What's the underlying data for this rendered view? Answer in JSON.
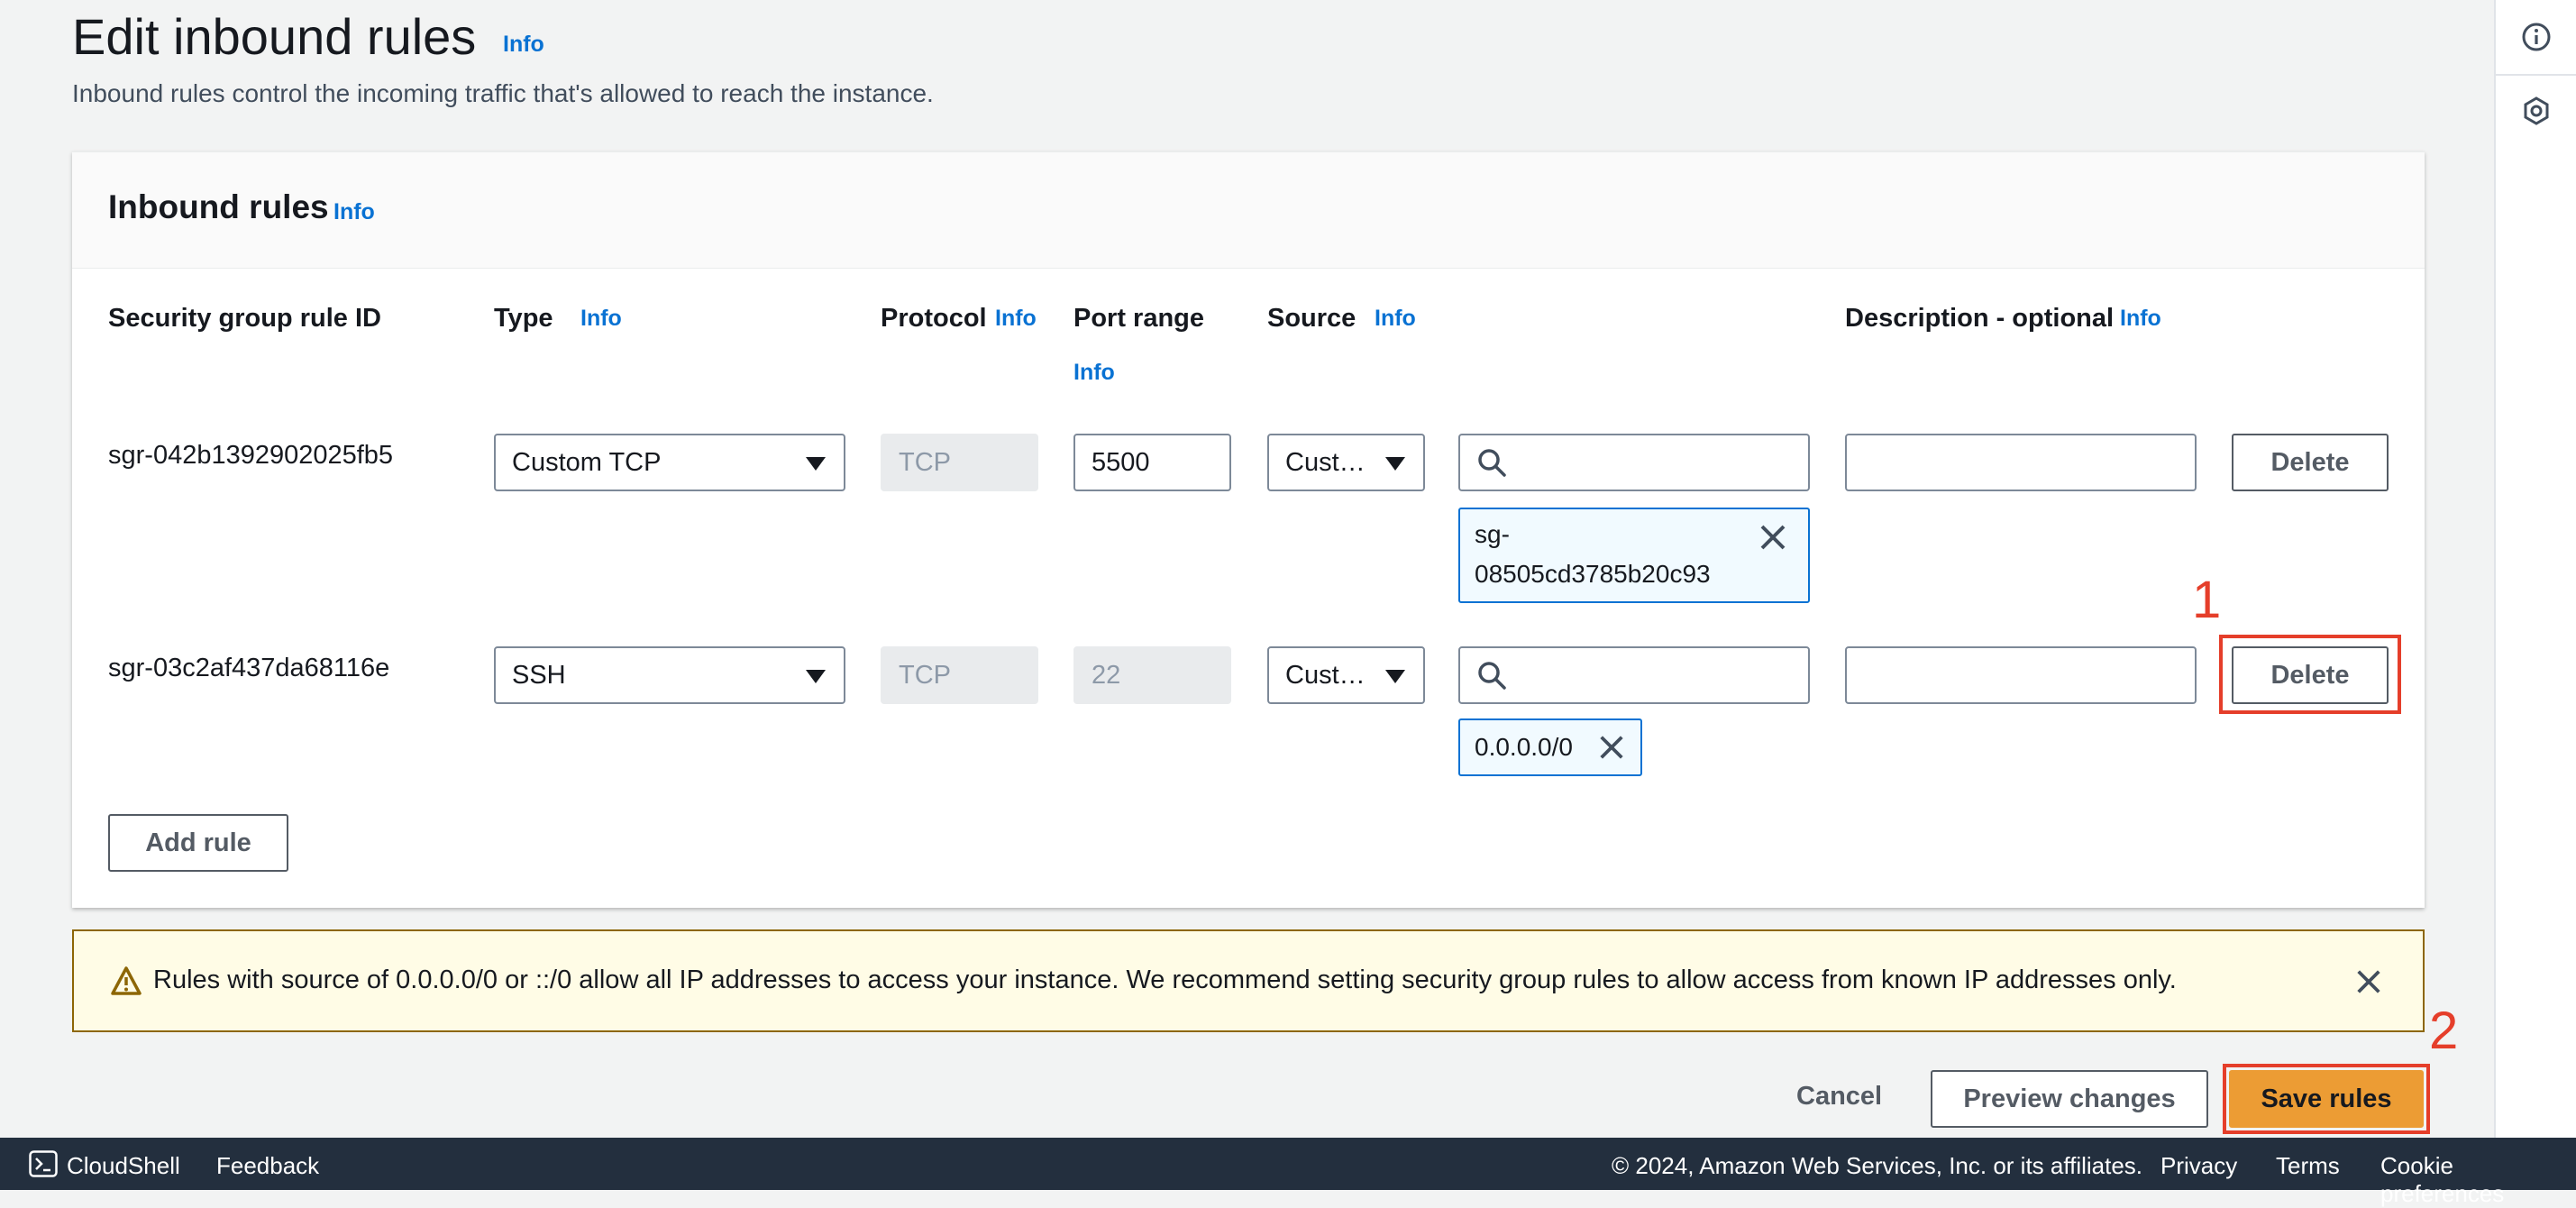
{
  "header": {
    "title": "Edit inbound rules",
    "info": "Info",
    "description": "Inbound rules control the incoming traffic that's allowed to reach the instance."
  },
  "panel": {
    "title": "Inbound rules",
    "info": "Info",
    "columns": {
      "rule_id": "Security group rule ID",
      "type": "Type",
      "protocol": "Protocol",
      "port_range": "Port range",
      "source": "Source",
      "description": "Description - optional",
      "info": "Info"
    },
    "rules": [
      {
        "rule_id": "sgr-042b1392902025fb5",
        "type": "Custom TCP",
        "protocol": "TCP",
        "port_range": "5500",
        "source_type": "Cust…",
        "source_search": "",
        "source_token_line1": "sg-",
        "source_token_line2": "08505cd3785b20c93",
        "description": "",
        "delete_label": "Delete"
      },
      {
        "rule_id": "sgr-03c2af437da68116e",
        "type": "SSH",
        "protocol": "TCP",
        "port_range": "22",
        "source_type": "Cust…",
        "source_search": "",
        "source_token": "0.0.0.0/0",
        "description": "",
        "delete_label": "Delete"
      }
    ],
    "add_rule_label": "Add rule"
  },
  "warning": {
    "text": "Rules with source of 0.0.0.0/0 or ::/0 allow all IP addresses to access your instance. We recommend setting security group rules to allow access from known IP addresses only."
  },
  "actions": {
    "cancel": "Cancel",
    "preview": "Preview changes",
    "save": "Save rules"
  },
  "annotations": {
    "step1": "1",
    "step2": "2"
  },
  "bottombar": {
    "cloudshell": "CloudShell",
    "feedback": "Feedback",
    "copyright": "© 2024, Amazon Web Services, Inc. or its affiliates.",
    "privacy": "Privacy",
    "terms": "Terms",
    "cookies": "Cookie preferences"
  },
  "colors": {
    "accent_link": "#0972d3",
    "primary_button": "#ec9c34",
    "annotation_red": "#e53e2a",
    "warning_border": "#8d6605",
    "bottombar_bg": "#232f3e"
  }
}
